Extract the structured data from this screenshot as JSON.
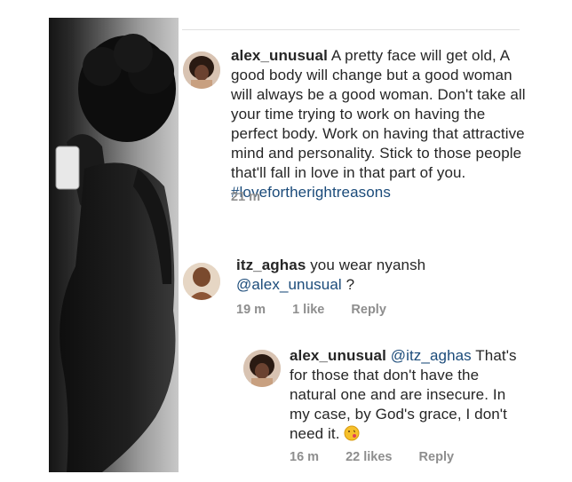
{
  "comments": [
    {
      "username": "alex_unusual",
      "text": "A pretty face will get old, A good body will change but a good woman will always be a good woman. Don't take all your time trying to work on having the perfect body. Work on having that attractive mind and personality. Stick to those people that'll fall in love in that part of you.",
      "hashtag": "#lovefortherightreasons",
      "time": "21 m"
    },
    {
      "username": "itz_aghas",
      "text": "you wear nyansh",
      "mention": "@alex_unusual",
      "suffix": " ?",
      "time": "19 m",
      "likes": "1 like",
      "reply": "Reply"
    },
    {
      "username": "alex_unusual",
      "mention": "@itz_aghas",
      "text": " That's for those that don't have the natural one and are insecure. In my case, by God's grace, I don't need it.",
      "emoji": "kiss-face-emoji",
      "time": "16 m",
      "likes": "22 likes",
      "reply": "Reply"
    }
  ],
  "colors": {
    "text": "#262626",
    "link": "#1b4b7a",
    "meta": "#8e8e8e"
  }
}
